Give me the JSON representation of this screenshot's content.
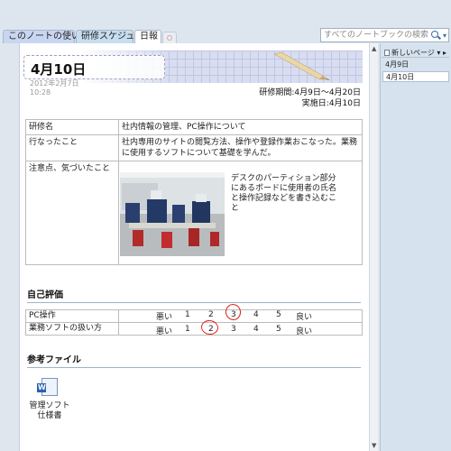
{
  "tabs": [
    {
      "label": "このノートの使い方"
    },
    {
      "label": "研修スケジュール"
    },
    {
      "label": "日報"
    }
  ],
  "search": {
    "placeholder": "すべてのノートブックの検索 (Ctrl+E)"
  },
  "page": {
    "title": "4月10日",
    "date": "2012年2月7日",
    "time": "10:28",
    "period": "研修期間:4月9日〜4月20日",
    "implementation": "実施日:4月10日"
  },
  "info_table": {
    "rows": [
      {
        "key": "研修名",
        "value": "社内情報の管理、PC操作について"
      },
      {
        "key": "行なったこと",
        "value": "社内専用のサイトの閲覧方法、操作や登録作業おこなった。業務に使用するソフトについて基礎を学んだ。"
      },
      {
        "key": "注意点、気づいたこと",
        "value": ""
      }
    ],
    "photo_note": "デスクのパーティション部分にあるボードに使用者の氏名と操作記録などを書き込むこと"
  },
  "self_evaluation": {
    "heading": "自己評価",
    "low_label": "悪い",
    "high_label": "良い",
    "scale": [
      "1",
      "2",
      "3",
      "4",
      "5"
    ],
    "rows": [
      {
        "label": "PC操作",
        "selected": 3
      },
      {
        "label": "業務ソフトの扱い方",
        "selected": 2
      }
    ]
  },
  "references": {
    "heading": "参考ファイル",
    "file_label": "管理ソフト仕様書",
    "file_icon": "word-document-icon"
  },
  "right_pane": {
    "new_page_label": "新しいページ",
    "pages": [
      "4月9日",
      "4月10日"
    ]
  },
  "colors": {
    "circle_mark": "#e02020",
    "grid_banner": "#d9ddf0"
  }
}
